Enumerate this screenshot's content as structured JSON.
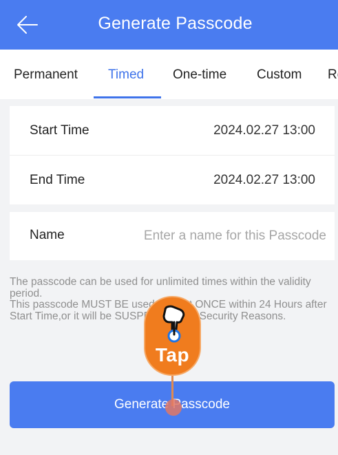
{
  "header": {
    "title": "Generate Passcode",
    "back_icon": "arrow-left-icon"
  },
  "tabs": [
    {
      "label": "Permanent",
      "active": false
    },
    {
      "label": "Timed",
      "active": true
    },
    {
      "label": "One-time",
      "active": false
    },
    {
      "label": "Custom",
      "active": false
    },
    {
      "label": "Re",
      "active": false
    }
  ],
  "time_card": {
    "start_label": "Start Time",
    "start_value": "2024.02.27 13:00",
    "end_label": "End Time",
    "end_value": "2024.02.27 13:00"
  },
  "name_card": {
    "label": "Name",
    "placeholder": "Enter a name for this Passcode",
    "value": ""
  },
  "notice": {
    "line1": "The passcode can be used for unlimited times within the validity period.",
    "line2": "This passcode MUST BE used at least ONCE within 24 Hours after Start Time,or it will be SUSPENDED for Security Reasons."
  },
  "generate_button": {
    "label": "Generate Passcode"
  },
  "tap_hint": {
    "label": "Tap",
    "icon": "pointing-hand-icon"
  },
  "colors": {
    "primary": "#4a7cf0",
    "tab_active": "#3e73ea",
    "tap_orange": "#f07c1e"
  }
}
